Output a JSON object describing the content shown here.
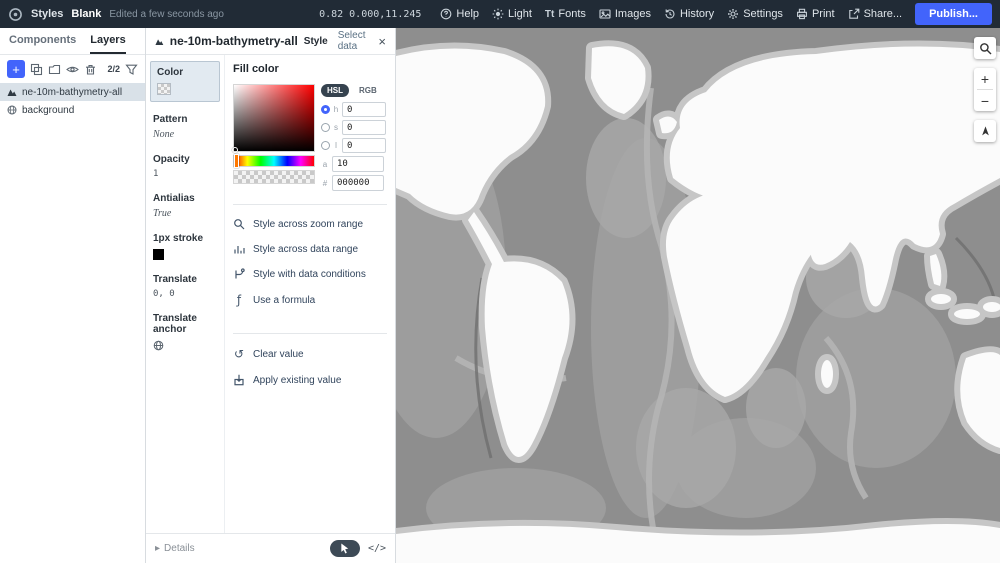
{
  "topbar": {
    "styles_label": "Styles",
    "style_name": "Blank",
    "edited_label": "Edited a few seconds ago",
    "status_coords": "0.82 0.000,11.245",
    "menu": [
      {
        "icon": "help-icon",
        "label": "Help"
      },
      {
        "icon": "light-icon",
        "label": "Light"
      },
      {
        "icon": "fonts-icon",
        "label": "Fonts",
        "glyph": "Tt"
      },
      {
        "icon": "images-icon",
        "label": "Images"
      },
      {
        "icon": "history-icon",
        "label": "History"
      },
      {
        "icon": "settings-icon",
        "label": "Settings"
      },
      {
        "icon": "print-icon",
        "label": "Print"
      },
      {
        "icon": "share-icon",
        "label": "Share..."
      }
    ],
    "publish_label": "Publish...",
    "colors": {
      "bar_bg": "#212b36",
      "publish_blue": "#4264fb"
    }
  },
  "sidebar": {
    "tabs": [
      {
        "label": "Components"
      },
      {
        "label": "Layers"
      }
    ],
    "active_tab": "Layers",
    "tools": [
      "add",
      "duplicate",
      "group",
      "visibility",
      "delete",
      "filter"
    ],
    "layer_count": "2/2",
    "layers": [
      {
        "name": "ne-10m-bathymetry-all",
        "icon": "fill-layer-icon",
        "selected": true
      },
      {
        "name": "background",
        "icon": "background-layer-icon",
        "selected": false
      }
    ]
  },
  "panel": {
    "title": "ne-10m-bathymetry-all",
    "tabs": [
      {
        "label": "Style"
      },
      {
        "label": "Select data"
      }
    ],
    "close_glyph": "×",
    "properties": [
      {
        "label": "Color",
        "value": "",
        "swatch": "transparent-checker",
        "selected": true
      },
      {
        "label": "Pattern",
        "value": "None"
      },
      {
        "label": "Opacity",
        "value": "1"
      },
      {
        "label": "Antialias",
        "value": "True"
      },
      {
        "label": "1px stroke",
        "value": "",
        "swatch": "black"
      },
      {
        "label": "Translate",
        "value": "0, 0"
      },
      {
        "label": "Translate anchor",
        "value": "",
        "icon": "map-anchor-icon"
      }
    ],
    "editor": {
      "title": "Fill color",
      "modes": [
        {
          "label": "HSL",
          "active": true
        },
        {
          "label": "RGB",
          "active": false
        }
      ],
      "channels": [
        {
          "key": "h",
          "value": "0",
          "checked": true
        },
        {
          "key": "s",
          "value": "0",
          "checked": false
        },
        {
          "key": "l",
          "value": "0",
          "checked": false
        }
      ],
      "alpha": {
        "key": "a",
        "value": "10"
      },
      "hex": {
        "prefix": "#",
        "value": "000000"
      }
    },
    "options": [
      {
        "icon": "zoom-range-icon",
        "label": "Style across zoom range"
      },
      {
        "icon": "data-range-icon",
        "label": "Style across data range"
      },
      {
        "icon": "data-conditions-icon",
        "label": "Style with data conditions"
      },
      {
        "icon": "formula-icon",
        "label": "Use a formula",
        "glyph": "ƒ"
      }
    ],
    "actions": [
      {
        "icon": "clear-icon",
        "label": "Clear value",
        "glyph": "↺"
      },
      {
        "icon": "apply-icon",
        "label": "Apply existing value"
      }
    ],
    "footer": {
      "caret": "▸",
      "details_label": "Details",
      "code_label": "</>"
    }
  },
  "map": {
    "controls": {
      "zoom_in": "+",
      "zoom_out": "−"
    },
    "colors": {
      "ocean": "#8e8e8e",
      "shallow": "#c6c6c6",
      "land": "#fbfbfb"
    }
  }
}
